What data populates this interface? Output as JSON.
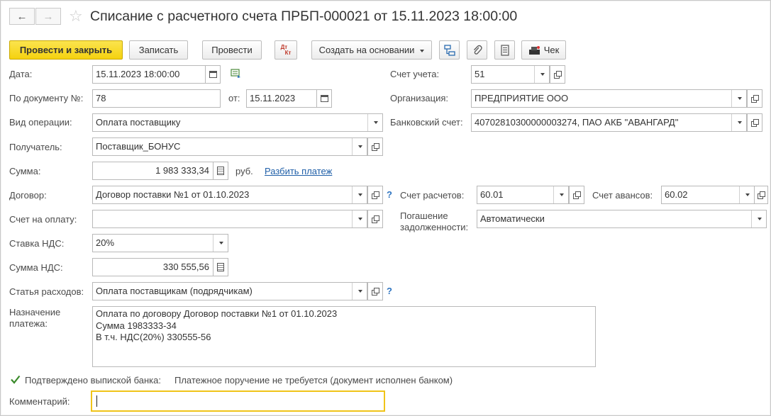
{
  "title": "Списание с расчетного счета ПРБП-000021 от 15.11.2023 18:00:00",
  "nav": {
    "back": "←",
    "forward": "→",
    "star": "☆"
  },
  "toolbar": {
    "post_close": "Провести и закрыть",
    "save": "Записать",
    "post": "Провести",
    "dt": "Дт",
    "kt": "Кт",
    "create_based": "Создать на основании",
    "receipt": "Чек"
  },
  "form": {
    "date_label": "Дата:",
    "date_value": "15.11.2023 18:00:00",
    "docnum_label": "По документу №:",
    "docnum_value": "78",
    "from_label": "от:",
    "from_value": "15.11.2023",
    "optype_label": "Вид операции:",
    "optype_value": "Оплата поставщику",
    "recipient_label": "Получатель:",
    "recipient_value": "Поставщик_БОНУС",
    "sum_label": "Сумма:",
    "sum_value": "1 983 333,34",
    "currency": "руб.",
    "split_link": "Разбить платеж",
    "contract_label": "Договор:",
    "contract_value": "Договор поставки №1 от 01.10.2023",
    "invoice_label": "Счет на оплату:",
    "invoice_value": "",
    "vat_rate_label": "Ставка НДС:",
    "vat_rate_value": "20%",
    "vat_sum_label": "Сумма НДС:",
    "vat_sum_value": "330 555,56",
    "expense_label": "Статья расходов:",
    "expense_value": "Оплата поставщикам (подрядчикам)",
    "purpose_label": "Назначение платежа:",
    "purpose_lines": [
      "Оплата по договору Договор поставки №1 от 01.10.2023",
      "Сумма 1983333-34",
      "В т.ч. НДС(20%) 330555-56"
    ],
    "account_label": "Счет учета:",
    "account_value": "51",
    "org_label": "Организация:",
    "org_value": "ПРЕДПРИЯТИЕ ООО",
    "bank_label": "Банковский счет:",
    "bank_value": "40702810300000003274, ПАО АКБ \"АВАНГАРД\"",
    "settle_label": "Счет расчетов:",
    "settle_value": "60.01",
    "advance_label": "Счет авансов:",
    "advance_value": "60.02",
    "repay_label": "Погашение задолженности:",
    "repay_value": "Автоматически",
    "confirmed_label": "Подтверждено выпиской банка:",
    "confirmed_note": "Платежное поручение не требуется (документ исполнен банком)",
    "comment_label": "Комментарий:",
    "comment_value": "",
    "question": "?"
  }
}
